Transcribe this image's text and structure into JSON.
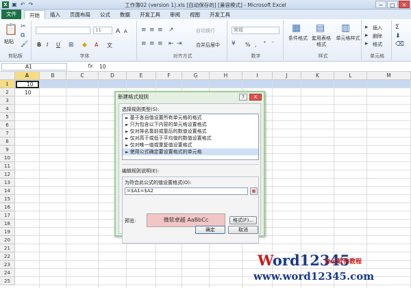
{
  "window": {
    "app_icon": "X",
    "title": "工作簿02 (version 1).xls [自动保存的] [兼容模式] - Microsoft Excel",
    "controls": [
      "─",
      "□",
      "✕"
    ]
  },
  "quick_access": [
    "save-icon",
    "undo-icon",
    "redo-icon"
  ],
  "tabs": [
    "文件",
    "开始",
    "插入",
    "页面布局",
    "公式",
    "数据",
    "开发工具",
    "审阅",
    "视图",
    "开发工具"
  ],
  "ribbon": {
    "clipboard": {
      "paste": "粘贴",
      "label": "剪贴板"
    },
    "font": {
      "size": "11",
      "grow": "A",
      "shrink": "A",
      "bold": "B",
      "italic": "I",
      "underline": "U",
      "color": "A",
      "wen": "文",
      "label": "字体"
    },
    "alignment": {
      "wrap": "自动换行",
      "merge": "合并后居中",
      "label": "对齐方式"
    },
    "number": {
      "format": "常规",
      "percent": "%",
      "comma": ",",
      "label": "数字"
    },
    "styles": {
      "conditional": "条件格式",
      "table": "套用表格格式",
      "cell": "单元格样式",
      "label": "样式"
    },
    "cells": {
      "insert": "插入",
      "delete": "删除",
      "format": "格式",
      "label": "单元格"
    },
    "editing": {
      "sum": "Σ",
      "label": ""
    }
  },
  "formula_bar": {
    "name_box": "A1",
    "fx": "fx",
    "value": "10"
  },
  "sheet": {
    "columns": [
      "A",
      "B",
      "C",
      "D",
      "E",
      "F",
      "G",
      "H",
      "I",
      "J",
      "K",
      "L",
      "M"
    ],
    "rows": [
      "1",
      "2",
      "3",
      "4",
      "5",
      "6",
      "7",
      "8",
      "9",
      "10",
      "11",
      "12",
      "13",
      "14",
      "15",
      "16",
      "17",
      "18",
      "19",
      "20",
      "21",
      "22",
      "23",
      "24",
      "25"
    ],
    "a1": "10",
    "a2": "10"
  },
  "dialog": {
    "title": "新建格式规则",
    "help": "?",
    "close": "X",
    "select_type_label": "选择规则类型(S):",
    "rule_types": [
      "基于各自值设置所有单元格的格式",
      "只为包含以下内容的单元格设置格式",
      "仅对排名靠前或靠后的数值设置格式",
      "仅对高于或低于平均值的数值设置格式",
      "仅对唯一值或重复值设置格式",
      "使用公式确定要设置格式的单元格"
    ],
    "edit_desc_label": "编辑规则说明(E):",
    "formula_label": "为符合此公式的值设置格式(O):",
    "formula_value": "=$A1=$A2",
    "preview_label": "预览:",
    "preview_text": "微软卓越  AaBbCc",
    "format_button": "格式(F)...",
    "ok": "确定",
    "cancel": "取消"
  },
  "watermark": {
    "prefix": "W",
    "rest": "ord12345",
    "tag": "办公软件教程",
    "url": "www.word12345.com"
  }
}
